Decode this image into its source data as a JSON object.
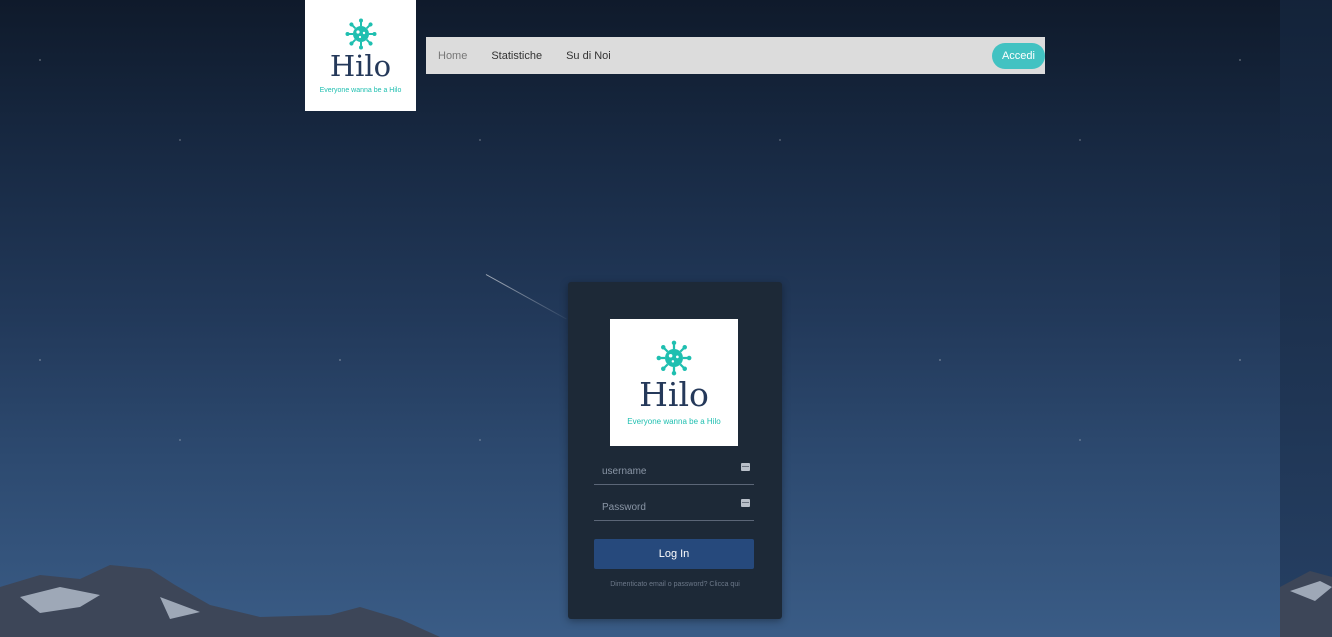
{
  "brand": {
    "name": "Hilo",
    "tagline": "Everyone wanna be a Hilo",
    "accent": "#1fbfb0",
    "icon": "virus-icon"
  },
  "nav": {
    "items": [
      {
        "label": "Home"
      },
      {
        "label": "Statistiche"
      },
      {
        "label": "Su di Noi"
      }
    ],
    "cta_label": "Accedi",
    "cta_color": "#42c2c2"
  },
  "login": {
    "username_placeholder": "username",
    "password_placeholder": "Password",
    "submit_label": "Log In",
    "submit_color": "#26497c",
    "forgot_text": "Dimenticato email o password? Clicca qui",
    "field_icon": "keyboard-icon"
  }
}
